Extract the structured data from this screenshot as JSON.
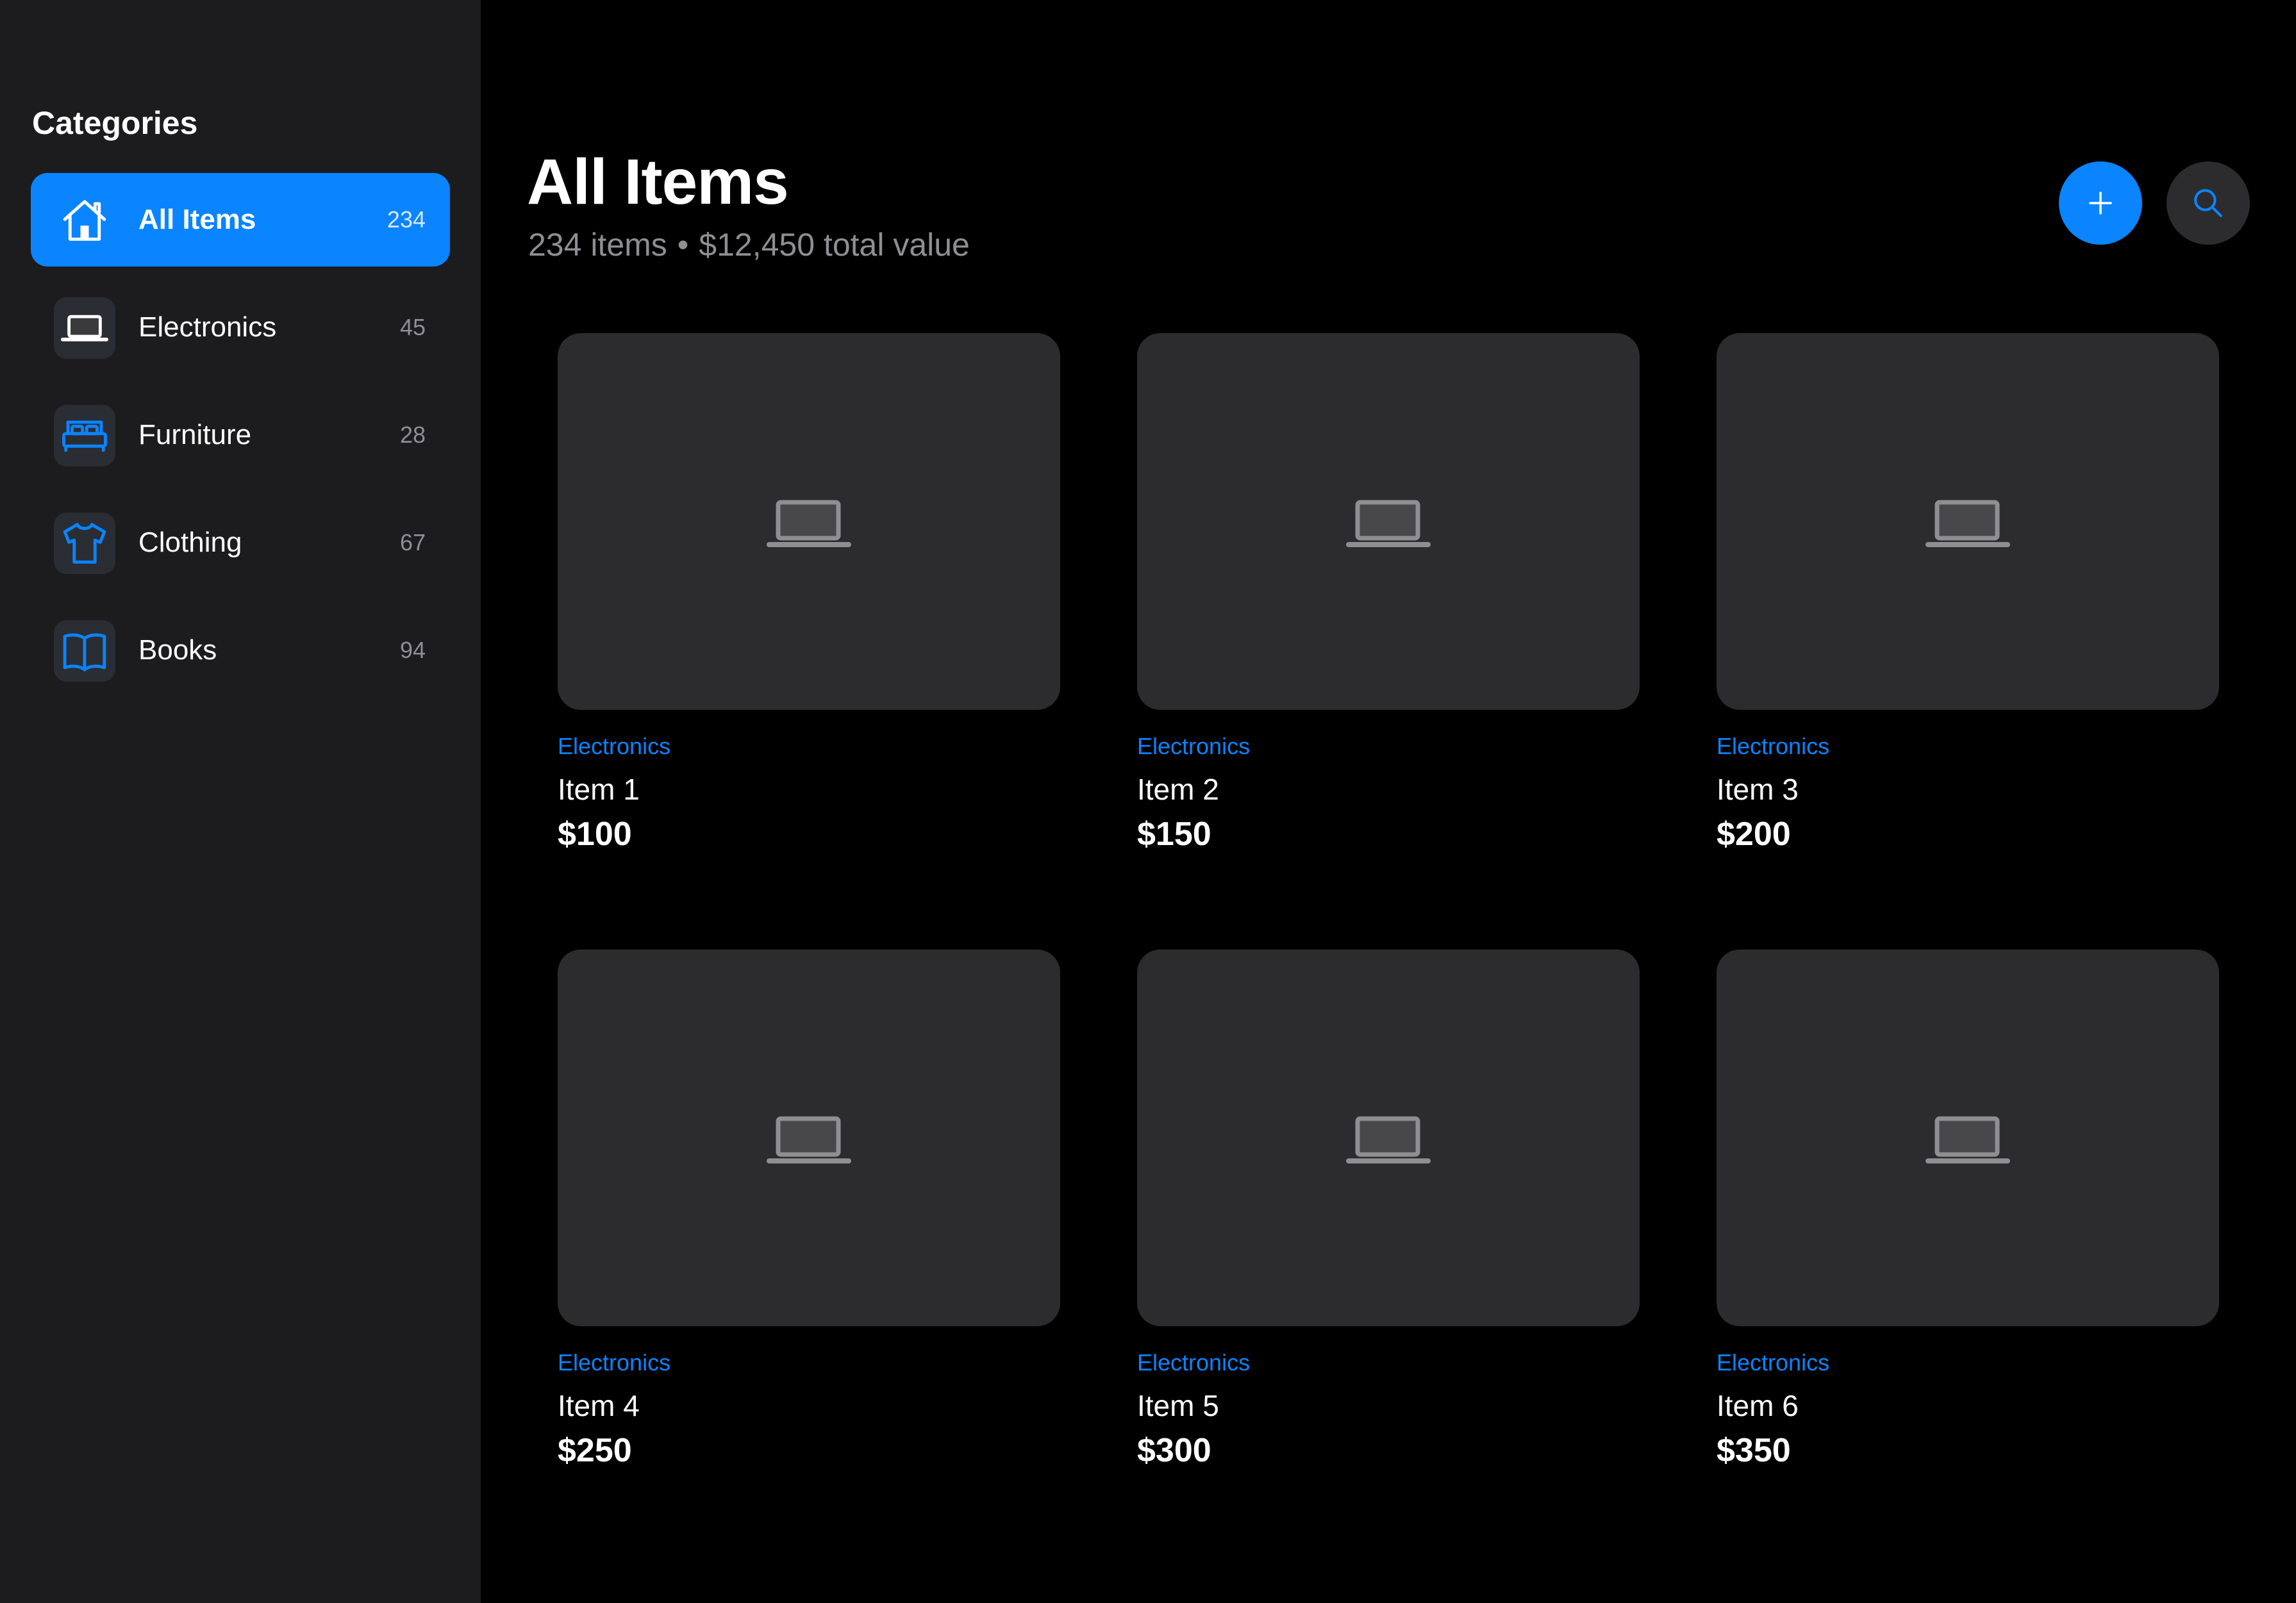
{
  "sidebar": {
    "heading": "Categories",
    "items": [
      {
        "label": "All Items",
        "count": "234",
        "icon": "house-icon",
        "selected": true
      },
      {
        "label": "Electronics",
        "count": "45",
        "icon": "laptop-icon",
        "selected": false
      },
      {
        "label": "Furniture",
        "count": "28",
        "icon": "bed-icon",
        "selected": false
      },
      {
        "label": "Clothing",
        "count": "67",
        "icon": "tshirt-icon",
        "selected": false
      },
      {
        "label": "Books",
        "count": "94",
        "icon": "book-icon",
        "selected": false
      }
    ]
  },
  "header": {
    "title": "All Items",
    "item_count": "234 items",
    "separator": "•",
    "total_value": "$12,450 total value",
    "add_button_icon": "plus-icon",
    "search_button_icon": "search-icon"
  },
  "items": [
    {
      "category": "Electronics",
      "name": "Item 1",
      "price": "$100",
      "icon": "laptop-icon"
    },
    {
      "category": "Electronics",
      "name": "Item 2",
      "price": "$150",
      "icon": "laptop-icon"
    },
    {
      "category": "Electronics",
      "name": "Item 3",
      "price": "$200",
      "icon": "laptop-icon"
    },
    {
      "category": "Electronics",
      "name": "Item 4",
      "price": "$250",
      "icon": "laptop-icon"
    },
    {
      "category": "Electronics",
      "name": "Item 5",
      "price": "$300",
      "icon": "laptop-icon"
    },
    {
      "category": "Electronics",
      "name": "Item 6",
      "price": "$350",
      "icon": "laptop-icon"
    }
  ],
  "colors": {
    "accent": "#0a84ff",
    "sidebar_background": "#1c1c1e",
    "main_background": "#000000",
    "card_background": "#2c2c2e",
    "secondary_text": "#8e8e93",
    "placeholder_icon": "#8e8e93"
  }
}
